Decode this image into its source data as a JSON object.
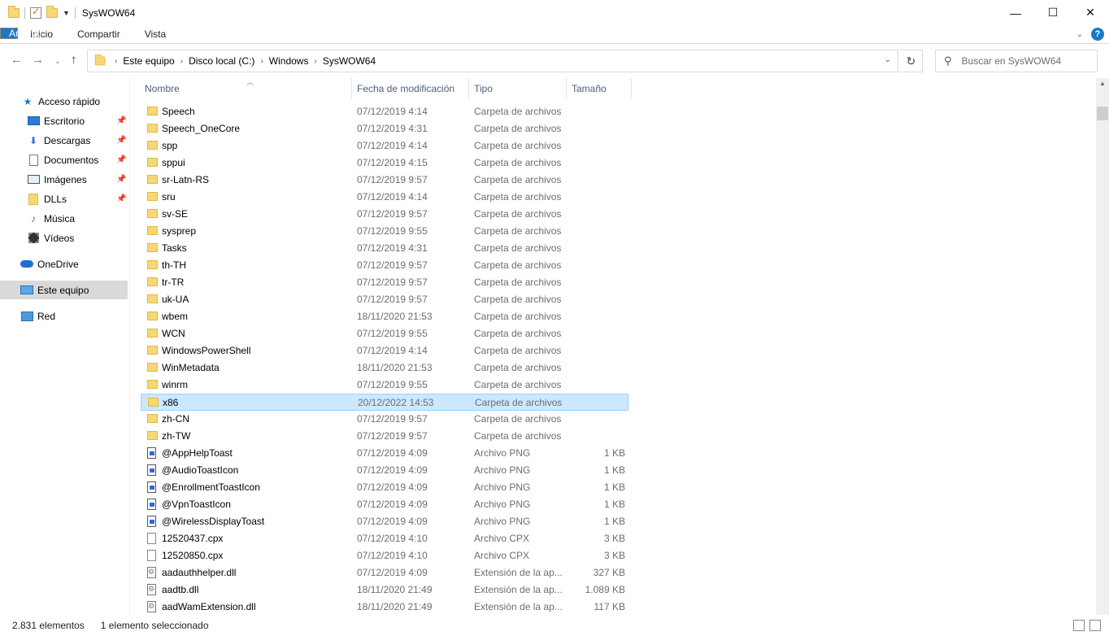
{
  "window": {
    "title": "SysWOW64",
    "minimize": "—",
    "maximize": "☐",
    "close": "✕"
  },
  "ribbon": {
    "tabs": [
      "Archivo",
      "Inicio",
      "Compartir",
      "Vista"
    ],
    "help": "?"
  },
  "address": {
    "breadcrumb": [
      "Este equipo",
      "Disco local (C:)",
      "Windows",
      "SysWOW64"
    ],
    "search_placeholder": "Buscar en SysWOW64"
  },
  "nav": {
    "quick_access": "Acceso rápido",
    "items": [
      "Escritorio",
      "Descargas",
      "Documentos",
      "Imágenes",
      "DLLs",
      "Música",
      "Vídeos"
    ],
    "onedrive": "OneDrive",
    "this_pc": "Este equipo",
    "network": "Red"
  },
  "columns": {
    "name": "Nombre",
    "date": "Fecha de modificación",
    "type": "Tipo",
    "size": "Tamaño"
  },
  "files": [
    {
      "name": "Speech",
      "date": "07/12/2019 4:14",
      "type": "Carpeta de archivos",
      "size": "",
      "icon": "folder-icon"
    },
    {
      "name": "Speech_OneCore",
      "date": "07/12/2019 4:31",
      "type": "Carpeta de archivos",
      "size": "",
      "icon": "folder-icon"
    },
    {
      "name": "spp",
      "date": "07/12/2019 4:14",
      "type": "Carpeta de archivos",
      "size": "",
      "icon": "folder-icon"
    },
    {
      "name": "sppui",
      "date": "07/12/2019 4:15",
      "type": "Carpeta de archivos",
      "size": "",
      "icon": "folder-icon"
    },
    {
      "name": "sr-Latn-RS",
      "date": "07/12/2019 9:57",
      "type": "Carpeta de archivos",
      "size": "",
      "icon": "folder-icon"
    },
    {
      "name": "sru",
      "date": "07/12/2019 4:14",
      "type": "Carpeta de archivos",
      "size": "",
      "icon": "folder-icon"
    },
    {
      "name": "sv-SE",
      "date": "07/12/2019 9:57",
      "type": "Carpeta de archivos",
      "size": "",
      "icon": "folder-icon"
    },
    {
      "name": "sysprep",
      "date": "07/12/2019 9:55",
      "type": "Carpeta de archivos",
      "size": "",
      "icon": "folder-icon"
    },
    {
      "name": "Tasks",
      "date": "07/12/2019 4:31",
      "type": "Carpeta de archivos",
      "size": "",
      "icon": "folder-icon"
    },
    {
      "name": "th-TH",
      "date": "07/12/2019 9:57",
      "type": "Carpeta de archivos",
      "size": "",
      "icon": "folder-icon"
    },
    {
      "name": "tr-TR",
      "date": "07/12/2019 9:57",
      "type": "Carpeta de archivos",
      "size": "",
      "icon": "folder-icon"
    },
    {
      "name": "uk-UA",
      "date": "07/12/2019 9:57",
      "type": "Carpeta de archivos",
      "size": "",
      "icon": "folder-icon"
    },
    {
      "name": "wbem",
      "date": "18/11/2020 21:53",
      "type": "Carpeta de archivos",
      "size": "",
      "icon": "folder-icon"
    },
    {
      "name": "WCN",
      "date": "07/12/2019 9:55",
      "type": "Carpeta de archivos",
      "size": "",
      "icon": "folder-icon"
    },
    {
      "name": "WindowsPowerShell",
      "date": "07/12/2019 4:14",
      "type": "Carpeta de archivos",
      "size": "",
      "icon": "folder-icon"
    },
    {
      "name": "WinMetadata",
      "date": "18/11/2020 21:53",
      "type": "Carpeta de archivos",
      "size": "",
      "icon": "folder-icon"
    },
    {
      "name": "winrm",
      "date": "07/12/2019 9:55",
      "type": "Carpeta de archivos",
      "size": "",
      "icon": "folder-icon"
    },
    {
      "name": "x86",
      "date": "20/12/2022 14:53",
      "type": "Carpeta de archivos",
      "size": "",
      "icon": "folder-icon",
      "selected": true
    },
    {
      "name": "zh-CN",
      "date": "07/12/2019 9:57",
      "type": "Carpeta de archivos",
      "size": "",
      "icon": "folder-icon"
    },
    {
      "name": "zh-TW",
      "date": "07/12/2019 9:57",
      "type": "Carpeta de archivos",
      "size": "",
      "icon": "folder-icon"
    },
    {
      "name": "@AppHelpToast",
      "date": "07/12/2019 4:09",
      "type": "Archivo PNG",
      "size": "1 KB",
      "icon": "png-icon"
    },
    {
      "name": "@AudioToastIcon",
      "date": "07/12/2019 4:09",
      "type": "Archivo PNG",
      "size": "1 KB",
      "icon": "png-icon"
    },
    {
      "name": "@EnrollmentToastIcon",
      "date": "07/12/2019 4:09",
      "type": "Archivo PNG",
      "size": "1 KB",
      "icon": "png-icon"
    },
    {
      "name": "@VpnToastIcon",
      "date": "07/12/2019 4:09",
      "type": "Archivo PNG",
      "size": "1 KB",
      "icon": "png-icon"
    },
    {
      "name": "@WirelessDisplayToast",
      "date": "07/12/2019 4:09",
      "type": "Archivo PNG",
      "size": "1 KB",
      "icon": "png-icon"
    },
    {
      "name": "12520437.cpx",
      "date": "07/12/2019 4:10",
      "type": "Archivo CPX",
      "size": "3 KB",
      "icon": "file-icon"
    },
    {
      "name": "12520850.cpx",
      "date": "07/12/2019 4:10",
      "type": "Archivo CPX",
      "size": "3 KB",
      "icon": "file-icon"
    },
    {
      "name": "aadauthhelper.dll",
      "date": "07/12/2019 4:09",
      "type": "Extensión de la ap...",
      "size": "327 KB",
      "icon": "dll-icon"
    },
    {
      "name": "aadtb.dll",
      "date": "18/11/2020 21:49",
      "type": "Extensión de la ap...",
      "size": "1.089 KB",
      "icon": "dll-icon"
    },
    {
      "name": "aadWamExtension.dll",
      "date": "18/11/2020 21:49",
      "type": "Extensión de la ap...",
      "size": "117 KB",
      "icon": "dll-icon"
    }
  ],
  "status": {
    "count": "2.831 elementos",
    "selection": "1 elemento seleccionado"
  }
}
